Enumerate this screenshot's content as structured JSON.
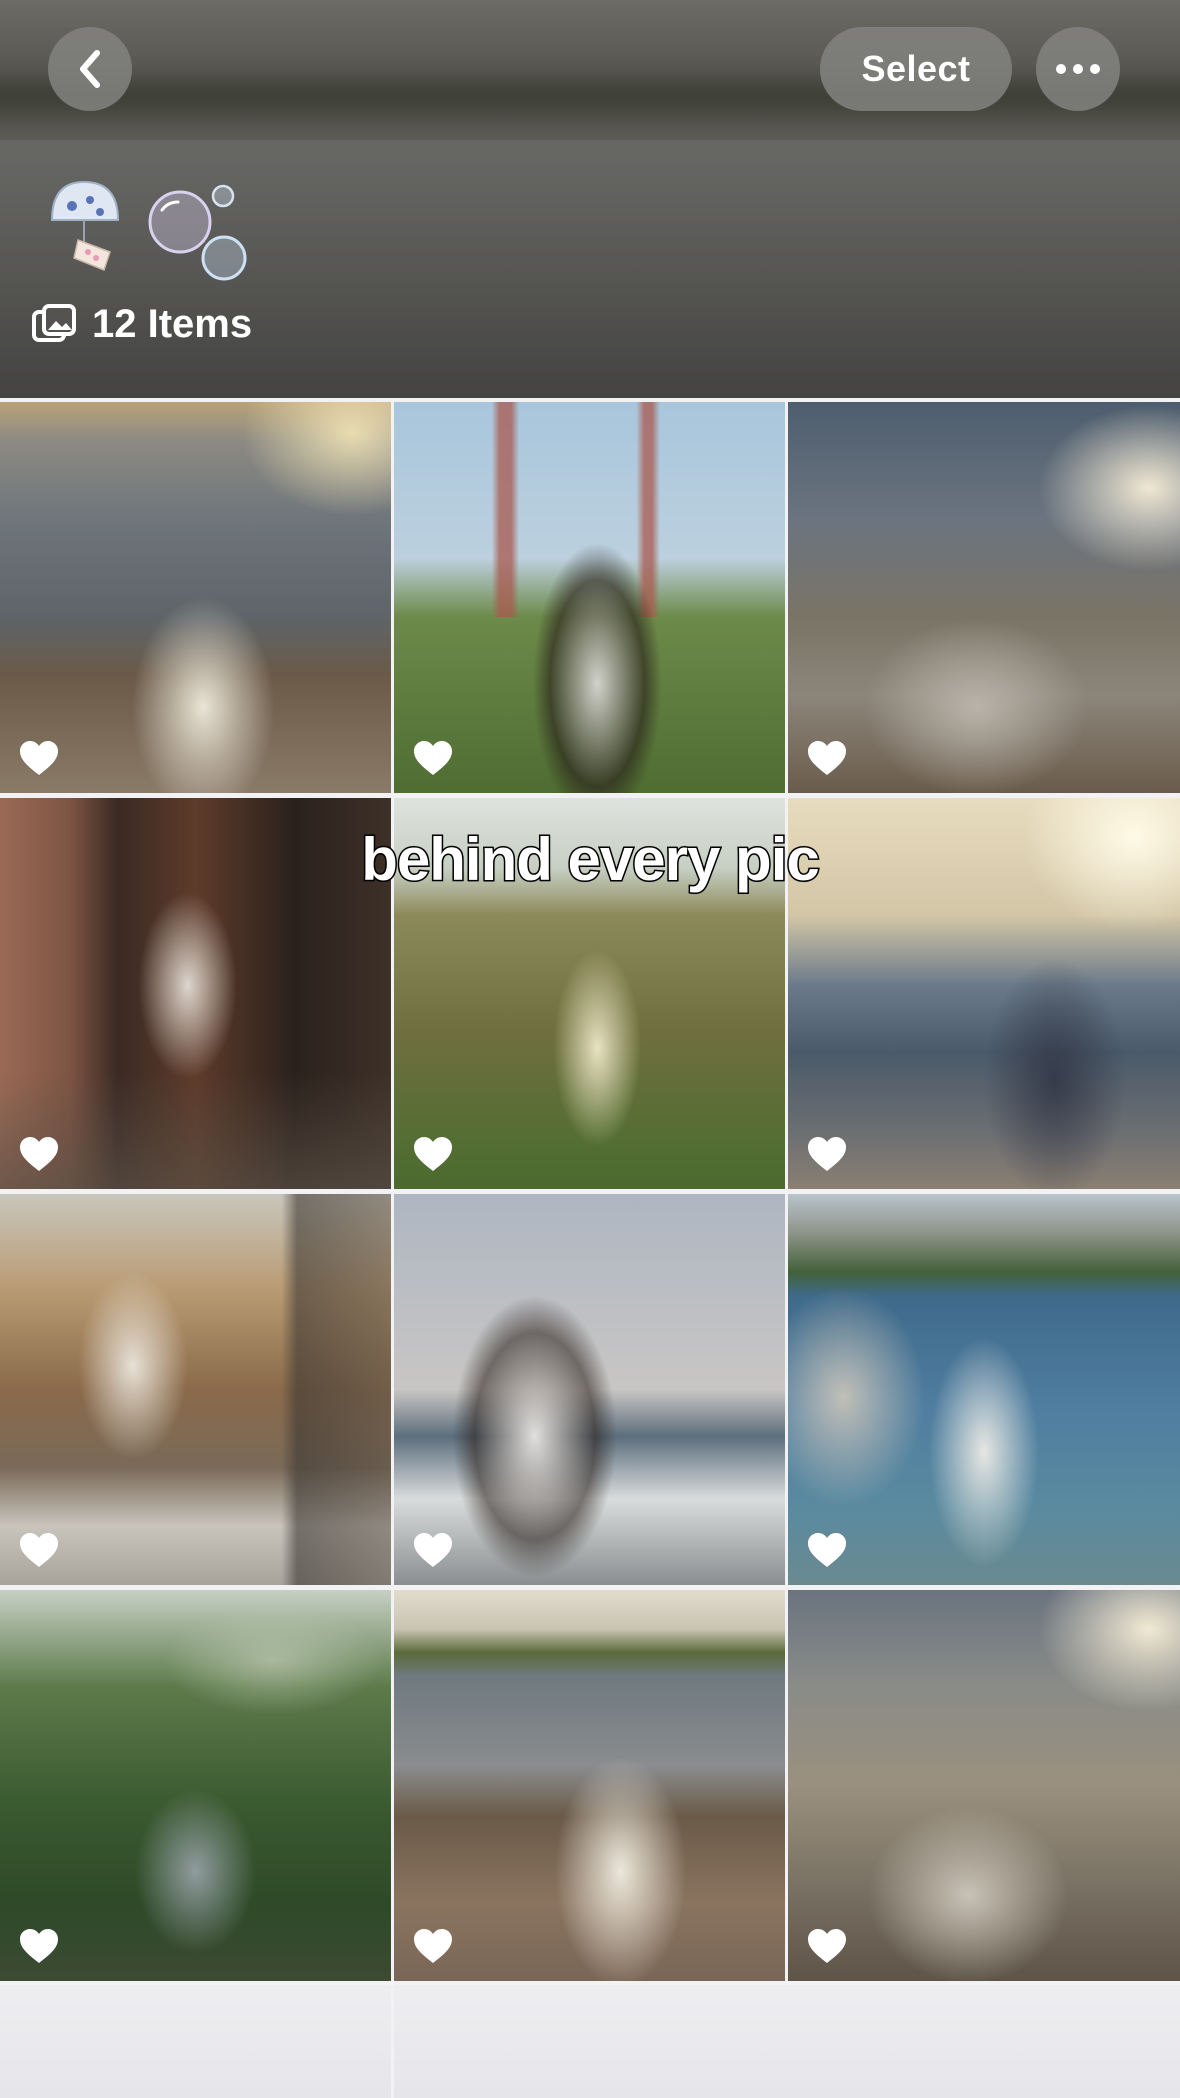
{
  "header": {
    "select_label": "Select",
    "items_label": "12 Items"
  },
  "overlay_caption": "behind every pic",
  "tiles": [
    {
      "id": 1,
      "favorite": true
    },
    {
      "id": 2,
      "favorite": true
    },
    {
      "id": 3,
      "favorite": true
    },
    {
      "id": 4,
      "favorite": true
    },
    {
      "id": 5,
      "favorite": true
    },
    {
      "id": 6,
      "favorite": true
    },
    {
      "id": 7,
      "favorite": true
    },
    {
      "id": 8,
      "favorite": true
    },
    {
      "id": 9,
      "favorite": true
    },
    {
      "id": 10,
      "favorite": true
    },
    {
      "id": 11,
      "favorite": true
    },
    {
      "id": 12,
      "favorite": true
    }
  ],
  "colors": {
    "button_bg": "#82827f",
    "heart": "#ffffff",
    "caption_fill": "#ffffff",
    "caption_stroke": "#000000"
  },
  "icons": [
    "back-chevron-icon",
    "more-ellipsis-icon",
    "photo-stack-icon",
    "heart-icon"
  ]
}
